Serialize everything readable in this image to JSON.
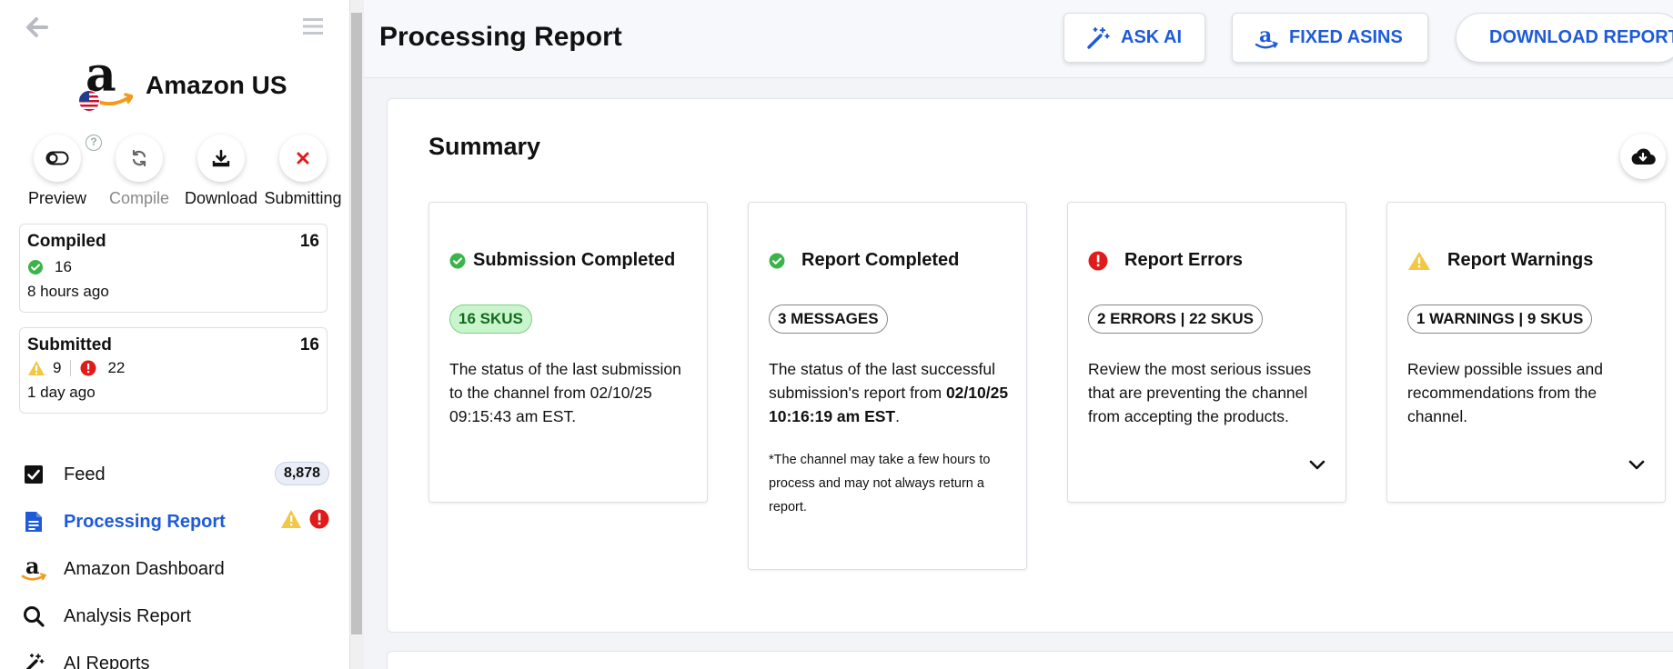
{
  "sidebar": {
    "store_name": "Amazon US",
    "actions": [
      {
        "label": "Preview"
      },
      {
        "label": "Compile"
      },
      {
        "label": "Download"
      },
      {
        "label": "Submitting"
      }
    ],
    "help_symbol": "?",
    "compiled": {
      "title": "Compiled",
      "total": "16",
      "success_count": "16",
      "time": "8 hours ago"
    },
    "submitted": {
      "title": "Submitted",
      "total": "16",
      "warning_count": "9",
      "error_count": "22",
      "time": "1 day ago"
    },
    "nav": [
      {
        "label": "Feed",
        "badge": "8,878",
        "icon": "checkbox-icon"
      },
      {
        "label": "Processing Report",
        "icon": "document-icon",
        "active": true
      },
      {
        "label": "Amazon Dashboard",
        "icon": "amazon-icon"
      },
      {
        "label": "Analysis Report",
        "icon": "search-icon"
      },
      {
        "label": "AI Reports",
        "icon": "magic-wand-icon"
      }
    ]
  },
  "header": {
    "title": "Processing Report",
    "buttons": {
      "ask_ai": "ASK AI",
      "fixed_asins": "FIXED ASINS",
      "download_report": "DOWNLOAD REPORT"
    }
  },
  "summary": {
    "title": "Summary",
    "cards": [
      {
        "title": "Submission Completed",
        "pill": "16 SKUS",
        "desc": "The status of the last submission to the channel from 02/10/25 09:15:43 am EST."
      },
      {
        "title": "Report Completed",
        "pill": "3 MESSAGES",
        "desc_prefix": "The status of the last successful submission's report from ",
        "desc_bold": "02/10/25 10:16:19 am EST",
        "desc_suffix": ".",
        "note": "*The channel may take a few hours to process and may not always return a report."
      },
      {
        "title": "Report Errors",
        "pill": "2 ERRORS | 22 SKUS",
        "desc": "Review the most serious issues that are preventing the channel from accepting the products."
      },
      {
        "title": "Report Warnings",
        "pill": "1 WARNINGS | 9 SKUS",
        "desc": "Review possible issues and recommendations from the channel."
      }
    ]
  },
  "colors": {
    "accent": "#1e5bd8",
    "success": "#3cb44b",
    "error": "#e01b1b",
    "warning": "#f2c744"
  }
}
